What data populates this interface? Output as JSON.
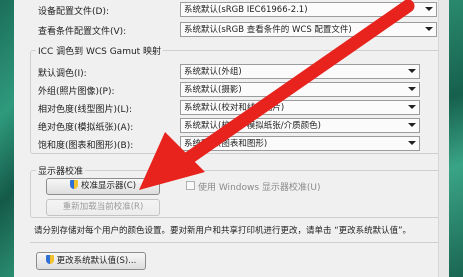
{
  "top_rows": [
    {
      "label": "设备配置文件(D):",
      "value": "系统默认(sRGB IEC61966-2.1)"
    },
    {
      "label": "查看条件配置文件(V):",
      "value": "系统默认(sRGB 查看条件的 WCS 配置文件)"
    }
  ],
  "gamut": {
    "title": "ICC 调色到 WCS Gamut 映射",
    "rows": [
      {
        "label": "默认调色(I):",
        "value": "系统默认(外组)"
      },
      {
        "label": "外组(照片图像)(P):",
        "value": "系统默认(摄影)"
      },
      {
        "label": "相对色度(线型图片)(L):",
        "value": "系统默认(校对和线条图片)"
      },
      {
        "label": "绝对色度(模拟纸张)(A):",
        "value": "系统默认(校对 - 模拟纸张/介质颜色)"
      },
      {
        "label": "饱和度(图表和图形)(B):",
        "value": "系统默认(图表和图形)"
      }
    ]
  },
  "calibration": {
    "title": "显示器校准",
    "calibrate_label": "校准显示器(C)",
    "reload_label": "重新加载当前校准(R)",
    "use_windows_label": "使用 Windows 显示器校准(U)"
  },
  "note": "请分别存储对每个用户的颜色设置。要对新用户和共享打印机进行更改，请单击 “更改系统默认值”。",
  "change_defaults_label": "更改系统默认值(S)...",
  "colors": {
    "arrow": "#e8231e",
    "accent": "#1f5fb0"
  }
}
